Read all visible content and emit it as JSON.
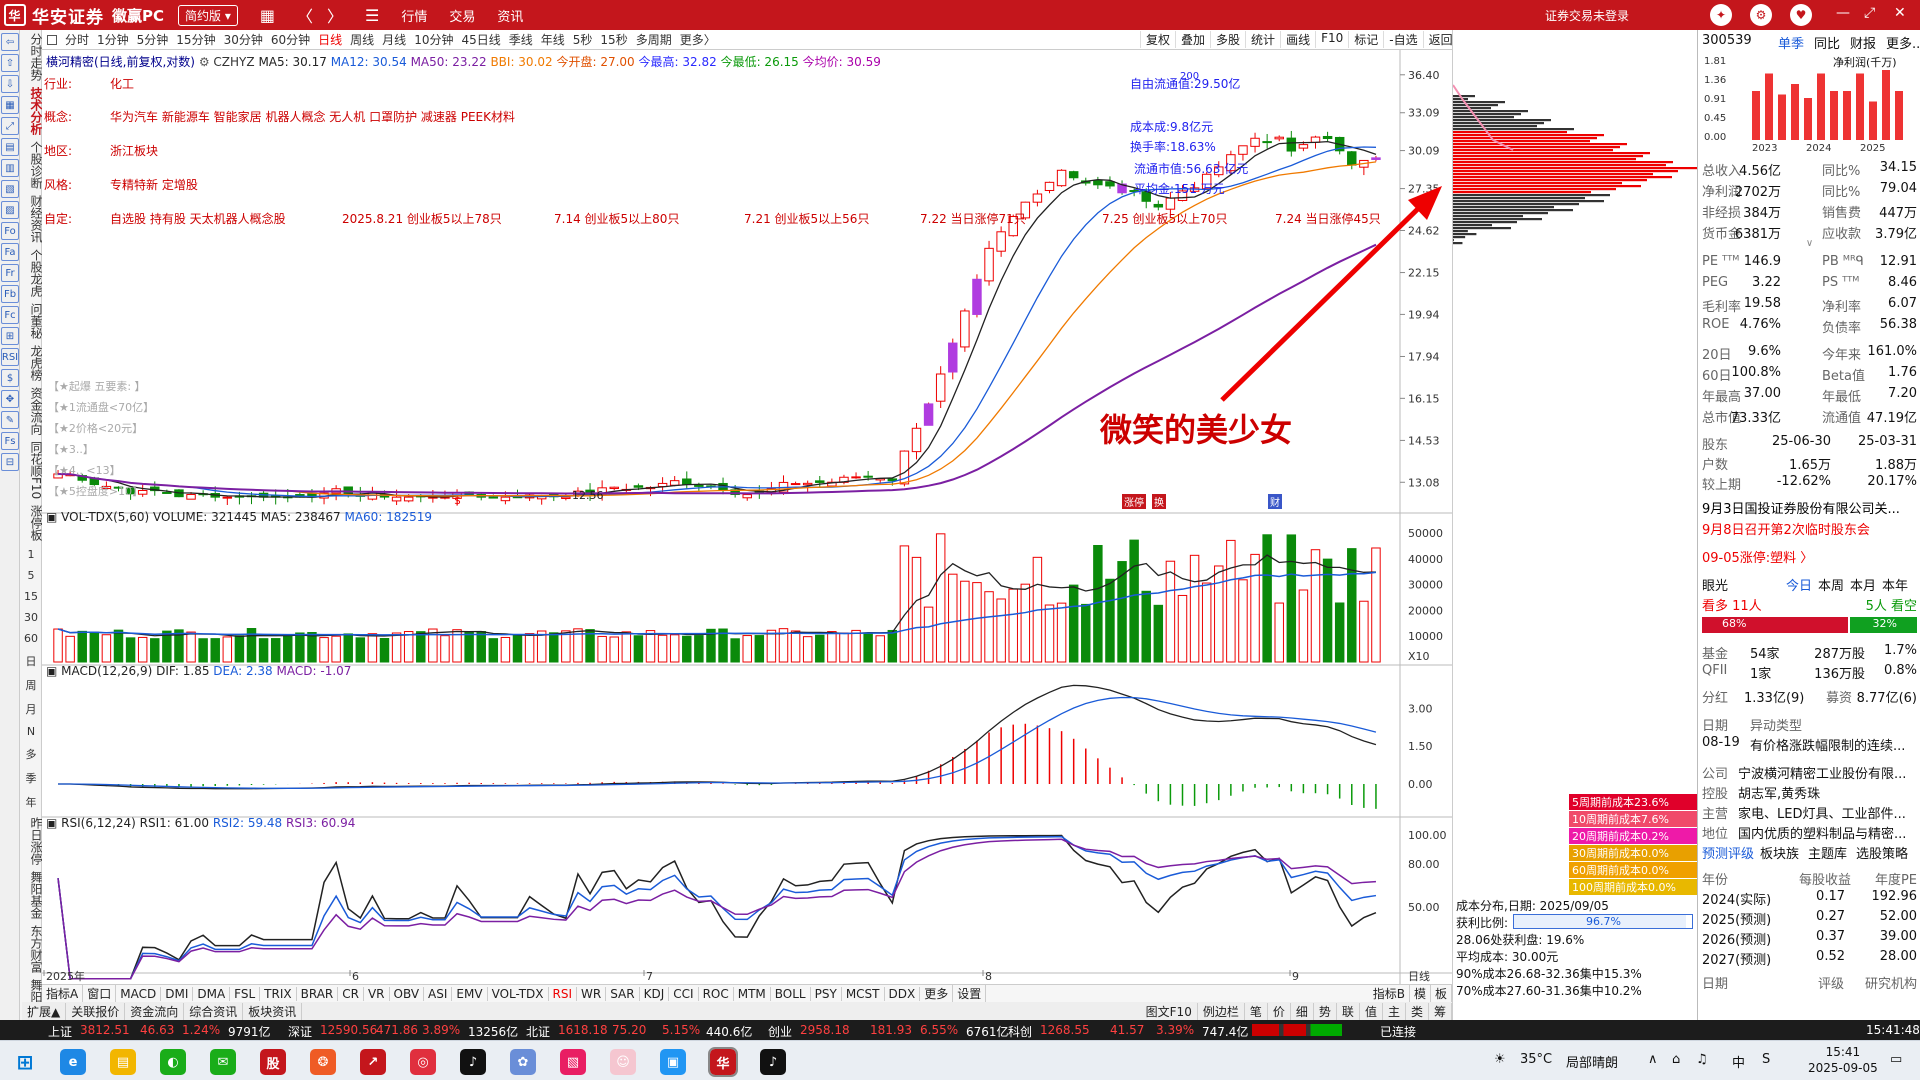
{
  "titlebar": {
    "logo_mark": "华",
    "brand": "华安证券",
    "app": "徽赢PC",
    "version": "简约版",
    "menus": [
      "行情",
      "交易",
      "资讯"
    ],
    "login_status": "证券交易未登录"
  },
  "lefttools": [
    "⇦",
    "⇧",
    "⇩",
    "▦",
    "⤢",
    "▤",
    "▥",
    "▧",
    "▨",
    "Fo",
    "Fa",
    "Fr",
    "Fb",
    "Fc",
    "⊞",
    "RSI",
    "$",
    "✥",
    "✎",
    "Fs",
    "⊟"
  ],
  "leftnav": {
    "vertical": [
      "分时走势",
      "技术分析",
      "个股诊断",
      "财经资讯",
      "个股龙虎",
      "问董秘",
      "龙虎榜",
      "资金流向",
      "同花顺F10",
      "涨停板"
    ],
    "numbers": [
      "1",
      "5",
      "15",
      "30",
      "60",
      "日",
      "周",
      "月",
      "N",
      "多",
      "季",
      "年"
    ],
    "vertical2": [
      "昨日涨停",
      "舞阳基金",
      "东方财富",
      "舞阳数据",
      "北向资金"
    ]
  },
  "periodbar": {
    "items": [
      "分时",
      "1分钟",
      "5分钟",
      "15分钟",
      "30分钟",
      "60分钟",
      "日线",
      "周线",
      "月线",
      "10分钟",
      "45日线",
      "季线",
      "年线",
      "5秒",
      "15秒",
      "多周期",
      "更多〉"
    ],
    "active": "日线"
  },
  "chart_tools": [
    "复权",
    "叠加",
    "多股",
    "统计",
    "画线",
    "F10",
    "标记",
    "-自选",
    "返回"
  ],
  "stock": {
    "name_line": "横河精密(日线,前复权,对数)",
    "indicator_name": "CZHYZ",
    "ma5": "MA5: 30.17",
    "ma12": "MA12: 30.54",
    "ma50": "MA50: 23.22",
    "bbi": "BBI: 30.02",
    "open": "今开盘: 27.00",
    "high": "今最高: 32.82",
    "low": "今最低: 26.15",
    "avg": "今均价: 30.59"
  },
  "info": {
    "industry_label": "行业:",
    "industry": "化工",
    "concept_label": "概念:",
    "concept": "华为汽车 新能源车 智能家居 机器人概念 无人机 口罩防护 减速器 PEEK材料",
    "region_label": "地区:",
    "region": "浙江板块",
    "style_label": "风格:",
    "style": "专精特新 定增股",
    "custom_label": "自定:",
    "custom": [
      "自选股 持有股 天太机器人概念股",
      "2025.8.21 创业板5以上78只",
      "7.14 创业板5以上80只",
      "7.21 创业板5以上56只"
    ]
  },
  "gray_notes": [
    "【★起爆 五要素: 】",
    "【★1流通盘<70亿】",
    "【★2价格<20元】",
    "【★3..】",
    "【★4..  <13】",
    "【★5控盘度>10】"
  ],
  "annotations": {
    "float_cap": "自由流通值:29.50亿",
    "cost": "成本成:9.8亿元",
    "turnover": "换手率:18.63%",
    "float_value": "流通市值:56.63 亿元",
    "amount": "平均金:151 万元",
    "n200": "200",
    "lab_722": "7.22 当日涨停71只",
    "lab_725": "7.25 创业板5以上70只",
    "lab_724": "7.24 当日涨停45只",
    "low_label": "12.56",
    "marker_zt": "涨停",
    "marker_hui": "换",
    "marker_sq": "财",
    "marker_dollar": "$"
  },
  "price_axis": [
    "36.40",
    "33.09",
    "30.09",
    "27.35",
    "24.62",
    "22.15",
    "19.94",
    "17.94",
    "16.15",
    "14.53",
    "13.08"
  ],
  "vol": {
    "header": "VOL-TDX(5,60)",
    "volume": "VOLUME: 321445",
    "ma5": "MA5: 238467",
    "ma60": "MA60: 182519",
    "axis": [
      "50000",
      "40000",
      "30000",
      "20000",
      "10000"
    ],
    "unit": "X10"
  },
  "macd": {
    "header": "MACD(12,26,9)",
    "dif": "DIF: 1.85",
    "dea": "DEA: 2.38",
    "macd": "MACD: -1.07",
    "axis": [
      "3.00",
      "1.50",
      "0.00"
    ]
  },
  "rsi": {
    "header": "RSI(6,12,24)",
    "rsi1": "RSI1: 61.00",
    "rsi2": "RSI2: 59.48",
    "rsi3": "RSI3: 60.94",
    "axis": [
      "100.00",
      "80.00",
      "50.00"
    ]
  },
  "date_axis": {
    "y2025": "2025年",
    "m6": "6",
    "m7": "7",
    "m8": "8",
    "m9": "9",
    "period": "日线"
  },
  "cost": {
    "labels": [
      {
        "text": "5周期前成本23.6%",
        "color": "#e0002a"
      },
      {
        "text": "10周期前成本7.6%",
        "color": "#f04a6a"
      },
      {
        "text": "20周期前成本0.2%",
        "color": "#ee1aa8"
      },
      {
        "text": "30周期前成本0.0%",
        "color": "#e8a000"
      },
      {
        "text": "60周期前成本0.0%",
        "color": "#f0a000"
      },
      {
        "text": "100周期前成本0.0%",
        "color": "#e8b800"
      }
    ],
    "date": "成本分布,日期: 2025/09/05",
    "profit_label": "获利比例:",
    "profit_value": "96.7%",
    "profit_fraction": 0.967,
    "l1": "28.06处获利盘: 19.6%",
    "l2": "平均成本: 30.00元",
    "l3": "90%成本26.68-32.36集中15.3%",
    "l4": "70%成本27.60-31.36集中10.2%"
  },
  "right": {
    "code": "300539",
    "name": "横河精密",
    "tabs": [
      "单季",
      "同比",
      "财报",
      "更多.."
    ],
    "fin_title": "净利润(千万)",
    "fin_y": [
      "1.81",
      "1.36",
      "0.91",
      "0.45",
      "0.00"
    ],
    "fin_x": [
      "2023",
      "2024",
      "2025"
    ],
    "fin_bars": [
      0.7,
      0.95,
      0.65,
      0.8,
      0.6,
      0.95,
      0.7,
      0.7,
      0.95,
      0.55,
      1.0,
      0.7
    ],
    "rows": [
      [
        "总收入",
        "4.56亿",
        "同比%",
        "34.15"
      ],
      [
        "净利润",
        "2702万",
        "同比%",
        "79.04"
      ],
      [
        "非经损",
        "384万",
        "销售费",
        "447万"
      ],
      [
        "货币金",
        "6381万",
        "应收款",
        "3.79亿"
      ]
    ],
    "rows2": [
      [
        "PE ᵀᵀᴹ",
        "146.9",
        "PB ᴹᴿᑫ",
        "12.91"
      ],
      [
        "PEG",
        "3.22",
        "PS ᵀᵀᴹ",
        "8.46"
      ],
      [
        "毛利率",
        "19.58",
        "净利率",
        "6.07"
      ],
      [
        "ROE",
        "4.76%",
        "负债率",
        "56.38"
      ]
    ],
    "rows3": [
      [
        "20日",
        "9.6%",
        "今年来",
        "161.0%"
      ],
      [
        "60日",
        "100.8%",
        "Beta值",
        "1.76"
      ],
      [
        "年最高",
        "37.00",
        "年最低",
        "7.20"
      ],
      [
        "总市值",
        "73.33亿",
        "流通值",
        "47.19亿"
      ]
    ],
    "rows4": [
      [
        "股东",
        "25-06-30",
        "25-03-31"
      ],
      [
        "户数",
        "1.65万",
        "1.88万"
      ],
      [
        "较上期",
        "-12.62%",
        "20.17%"
      ]
    ],
    "news1": "9月3日国投证券股份有限公司关...",
    "news2": "9月8日召开第2次临时股东会",
    "tag": "09-05涨停:塑料 〉",
    "eye": "眼光",
    "eye_tabs": [
      "今日",
      "本周",
      "本月",
      "本年"
    ],
    "bull": "看多 11人",
    "bear": "5人 看空",
    "bull_pct": "68%",
    "bear_pct": "32%",
    "bull_frac": 0.68,
    "fund_rows": [
      [
        "基金",
        "54家",
        "287万股",
        "1.7%"
      ],
      [
        "QFII",
        "1家",
        "136万股",
        "0.8%"
      ]
    ],
    "div": [
      "分红",
      "1.33亿(9)",
      "募资",
      "8.77亿(6)"
    ],
    "date_head": [
      "日期",
      "异动类型"
    ],
    "date_row": [
      "08-19",
      "有价格涨跌幅限制的连续..."
    ],
    "company": [
      [
        "公司",
        "宁波横河精密工业股份有限..."
      ],
      [
        "控股",
        "胡志军,黄秀珠"
      ],
      [
        "主营",
        "家电、LED灯具、工业部件..."
      ],
      [
        "地位",
        "国内优质的塑料制品与精密..."
      ]
    ],
    "links": [
      "预测评级",
      "板块族",
      "主题库",
      "选股策略"
    ],
    "forecast_head": [
      "年份",
      "每股收益",
      "年度PE"
    ],
    "forecast": [
      [
        "2024(实际)",
        "0.17",
        "192.96"
      ],
      [
        "2025(预测)",
        "0.27",
        "52.00"
      ],
      [
        "2026(预测)",
        "0.37",
        "39.00"
      ],
      [
        "2027(预测)",
        "0.52",
        "28.00"
      ]
    ],
    "bottom": [
      "日期",
      "评级",
      "研究机构"
    ]
  },
  "indicator_tabs": [
    "指标A",
    "窗口",
    "MACD",
    "DMI",
    "DMA",
    "FSL",
    "TRIX",
    "BRAR",
    "CR",
    "VR",
    "OBV",
    "ASI",
    "EMV",
    "VOL-TDX",
    "RSI",
    "WR",
    "SAR",
    "KDJ",
    "CCI",
    "ROC",
    "MTM",
    "BOLL",
    "PSY",
    "MCST",
    "DDX",
    "更多",
    "设置"
  ],
  "indicator_active": "RSI",
  "ind_right": [
    "指标B",
    "模",
    "板"
  ],
  "bottom_tabs": [
    "扩展▲",
    "关联报价",
    "资金流向",
    "综合资讯",
    "板块资讯"
  ],
  "bottom_right": [
    "图文F10",
    "例边栏",
    "笔",
    "价",
    "细",
    "势",
    "联",
    "值",
    "主",
    "类",
    "筹"
  ],
  "indexbar": {
    "sh": "上证",
    "sh_v": "3812.51",
    "sh_c": "46.63",
    "sh_p": "1.24%",
    "sh_a": "9791亿",
    "sz": "深证",
    "sz_v": "12590.56",
    "sz_c": "471.86",
    "sz_p": "3.89%",
    "sz_a": "13256亿",
    "bz": "北证",
    "bz_v": "1618.18",
    "bz_c": "75.20",
    "bz_p": "5.15%",
    "bz_a": "440.6亿",
    "cy": "创业",
    "cy_v": "2958.18",
    "cy_c": "181.93",
    "cy_p": "6.55%",
    "cy_a": "6761亿",
    "kc": "科创",
    "kc_v": "1268.55",
    "kc_c": "41.57",
    "kc_p": "3.39%",
    "kc_a": "747.4亿",
    "conn": "已连接",
    "time": "15:41:48"
  },
  "taskbar": {
    "temp": "35°C",
    "weather": "局部晴朗",
    "ime": "中",
    "time": "15:41",
    "date": "2025-09-05"
  },
  "watermark": "微笑的美少女"
}
